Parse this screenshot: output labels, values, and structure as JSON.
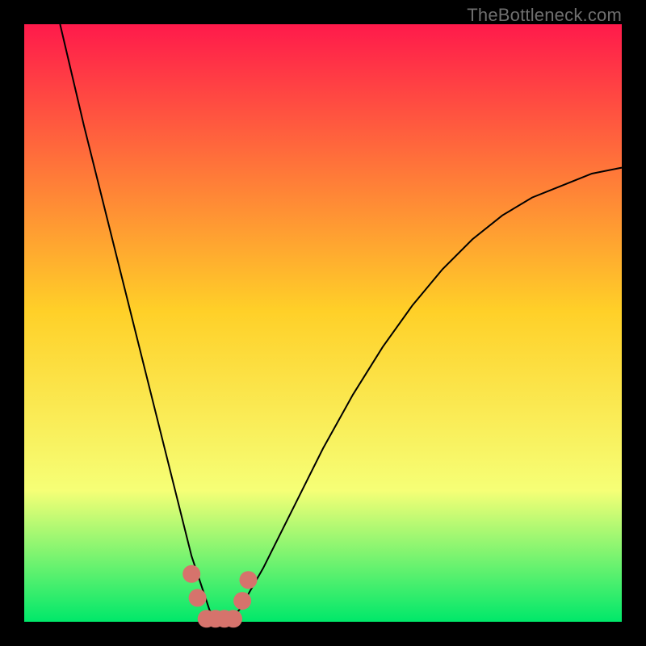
{
  "watermark": "TheBottleneck.com",
  "colors": {
    "black": "#000000",
    "gradient_top": "#ff1a4b",
    "gradient_mid": "#ffd028",
    "gradient_low": "#f6ff76",
    "gradient_bottom": "#00e86a",
    "curve": "#000000",
    "marker": "#d6736c"
  },
  "chart_data": {
    "type": "line",
    "title": "",
    "xlabel": "",
    "ylabel": "",
    "xlim": [
      0,
      100
    ],
    "ylim": [
      0,
      100
    ],
    "series": [
      {
        "name": "bottleneck-curve",
        "x": [
          6,
          10,
          14,
          18,
          22,
          26,
          28,
          30,
          31,
          32,
          34,
          36,
          40,
          45,
          50,
          55,
          60,
          65,
          70,
          75,
          80,
          85,
          90,
          95,
          100
        ],
        "y": [
          100,
          83,
          67,
          51,
          35,
          19,
          11,
          5,
          2,
          0,
          0,
          2,
          9,
          19,
          29,
          38,
          46,
          53,
          59,
          64,
          68,
          71,
          73,
          75,
          76
        ]
      }
    ],
    "markers": {
      "name": "highlighted-range",
      "points": [
        {
          "x": 28,
          "y": 8
        },
        {
          "x": 29,
          "y": 4
        },
        {
          "x": 30.5,
          "y": 0.5
        },
        {
          "x": 32,
          "y": 0.5
        },
        {
          "x": 33.5,
          "y": 0.5
        },
        {
          "x": 35,
          "y": 0.5
        },
        {
          "x": 36.5,
          "y": 3.5
        },
        {
          "x": 37.5,
          "y": 7
        }
      ]
    },
    "legend": []
  }
}
